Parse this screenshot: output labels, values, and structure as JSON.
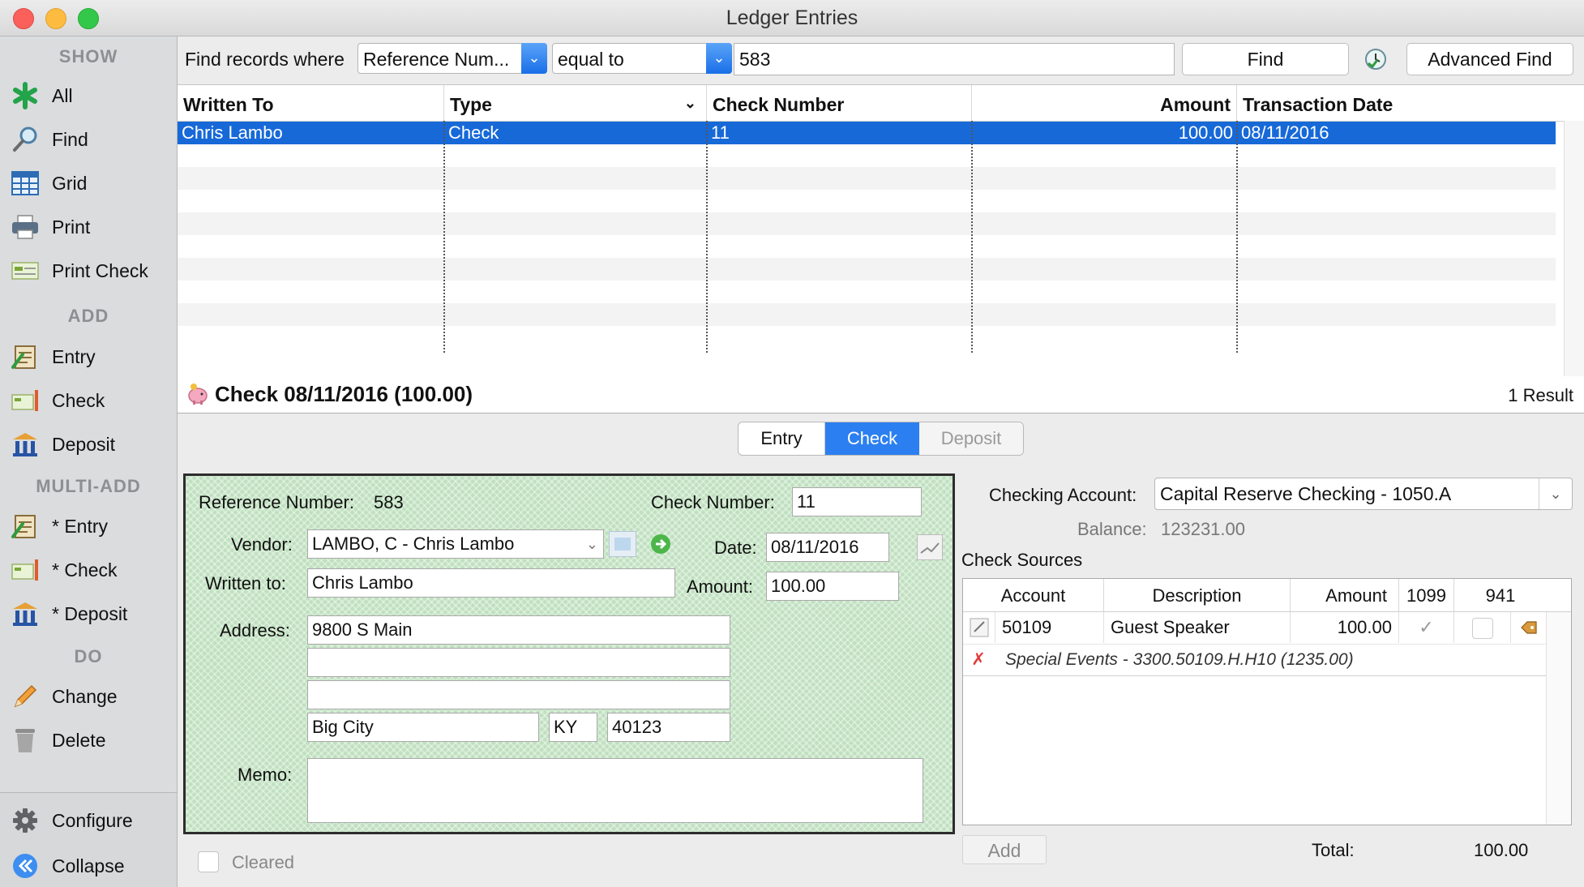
{
  "window": {
    "title": "Ledger Entries"
  },
  "sidebar": {
    "show_header": "SHOW",
    "show_items": [
      "All",
      "Find",
      "Grid",
      "Print",
      "Print Check"
    ],
    "add_header": "ADD",
    "add_items": [
      "Entry",
      "Check",
      "Deposit"
    ],
    "multi_header": "MULTI-ADD",
    "multi_items": [
      "* Entry",
      "* Check",
      "* Deposit"
    ],
    "do_header": "DO",
    "do_items": [
      "Change",
      "Delete"
    ],
    "bottom_items": [
      "Configure",
      "Collapse"
    ]
  },
  "findbar": {
    "label": "Find records where",
    "field_value": "Reference Num...",
    "operator_value": "equal to",
    "search_value": "583",
    "find_label": "Find",
    "advanced_label": "Advanced Find"
  },
  "grid": {
    "columns": [
      "Written To",
      "Type",
      "Check Number",
      "Amount",
      "Transaction Date"
    ],
    "rows": [
      {
        "written_to": "Chris Lambo",
        "type": "Check",
        "check_number": "11",
        "amount": "100.00",
        "date": "08/11/2016"
      }
    ]
  },
  "record": {
    "title": "Check 08/11/2016 (100.00)",
    "result_count": "1 Result"
  },
  "tabs": [
    "Entry",
    "Check",
    "Deposit"
  ],
  "check": {
    "reference_label": "Reference Number:",
    "reference_value": "583",
    "check_number_label": "Check Number:",
    "check_number_value": "11",
    "vendor_label": "Vendor:",
    "vendor_value": "LAMBO, C - Chris Lambo",
    "date_label": "Date:",
    "date_value": "08/11/2016",
    "written_to_label": "Written to:",
    "written_to_value": "Chris Lambo",
    "amount_label": "Amount:",
    "amount_value": "100.00",
    "address_label": "Address:",
    "address_line1": "9800 S Main",
    "address_line2": "",
    "address_line3": "",
    "city": "Big City",
    "state": "KY",
    "zip": "40123",
    "memo_label": "Memo:",
    "memo_value": ""
  },
  "cleared_label": "Cleared",
  "account": {
    "label": "Checking Account:",
    "value": "Capital Reserve Checking - 1050.A",
    "balance_label": "Balance:",
    "balance_value": "123231.00"
  },
  "sources": {
    "title": "Check Sources",
    "columns": [
      "Account",
      "Description",
      "Amount",
      "1099",
      "941"
    ],
    "row": {
      "account": "50109",
      "description": "Guest Speaker",
      "amount": "100.00"
    },
    "sub_row": "Special Events - 3300.50109.H.H10 (1235.00)",
    "add_label": "Add",
    "total_label": "Total:",
    "total_value": "100.00"
  },
  "colors": {
    "selection": "#1769d8",
    "accent": "#2c7ff0",
    "check_background": "#bfe0bf"
  }
}
